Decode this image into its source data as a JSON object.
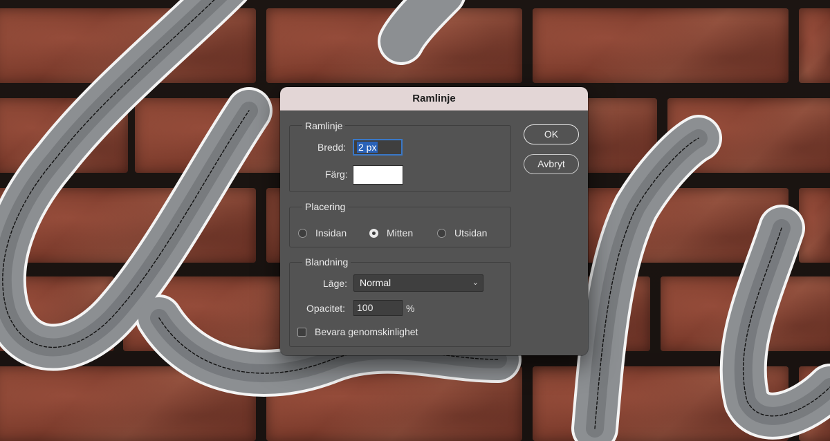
{
  "dialog": {
    "title": "Ramlinje",
    "stroke_group": {
      "title": "Ramlinje",
      "width_label": "Bredd:",
      "width_value": "2 px",
      "color_label": "Färg:",
      "color_value": "#ffffff"
    },
    "placement_group": {
      "title": "Placering",
      "options": [
        "Insidan",
        "Mitten",
        "Utsidan"
      ],
      "selected": "Mitten"
    },
    "blending_group": {
      "title": "Blandning",
      "mode_label": "Läge:",
      "mode_value": "Normal",
      "opacity_label": "Opacitet:",
      "opacity_value": "100",
      "opacity_unit": "%",
      "preserve_label": "Bevara genomskinlighet",
      "preserve_checked": false
    },
    "buttons": {
      "ok": "OK",
      "cancel": "Avbryt"
    }
  },
  "colors": {
    "dialog_bg": "#535353",
    "titlebar_bg": "#e3d6d6",
    "focus_accent": "#2a62b8",
    "brick": "#8a4634",
    "lettering": "#8c8f92"
  }
}
